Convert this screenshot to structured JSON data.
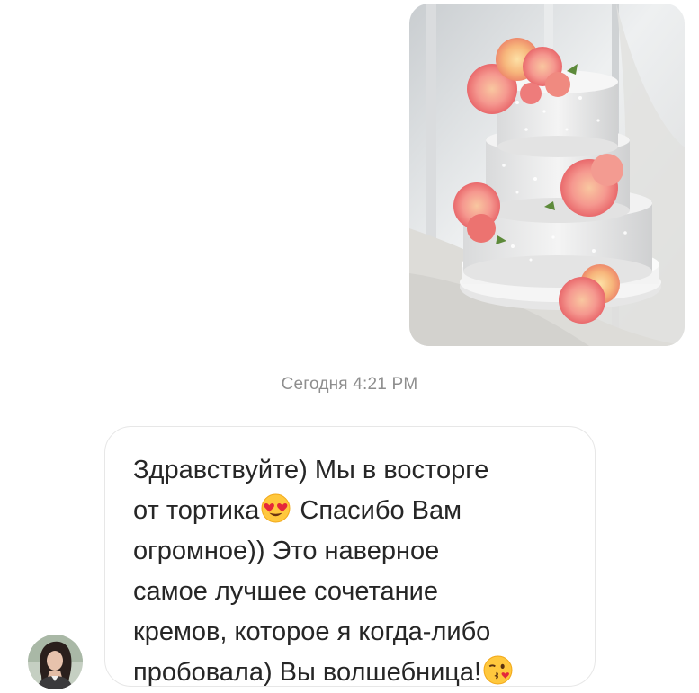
{
  "thread": {
    "sent_photo": {
      "subject": "three-tier white cake with coral roses"
    },
    "timestamp": "Сегодня 4:21 PM",
    "received_message": {
      "lines": [
        {
          "before": "Здравствуйте) Мы в восторге",
          "emoji": "",
          "after": ""
        },
        {
          "before": "от тортика",
          "emoji": "heart-eyes-emoji",
          "after": " Спасибо Вам"
        },
        {
          "before": "огромное)) Это наверное",
          "emoji": "",
          "after": ""
        },
        {
          "before": "самое лучшее сочетание",
          "emoji": "",
          "after": ""
        },
        {
          "before": "кремов, которое я когда-либо",
          "emoji": "",
          "after": ""
        },
        {
          "before": "пробовала) Вы волшебница!",
          "emoji": "kissing-wink-emoji",
          "after": ""
        }
      ]
    },
    "sender": {
      "avatar_icon": "user-avatar"
    }
  },
  "colors": {
    "timestamp": "#8e8e8e",
    "bubble_border": "#e7e7e7",
    "text": "#262626",
    "background": "#ffffff"
  }
}
